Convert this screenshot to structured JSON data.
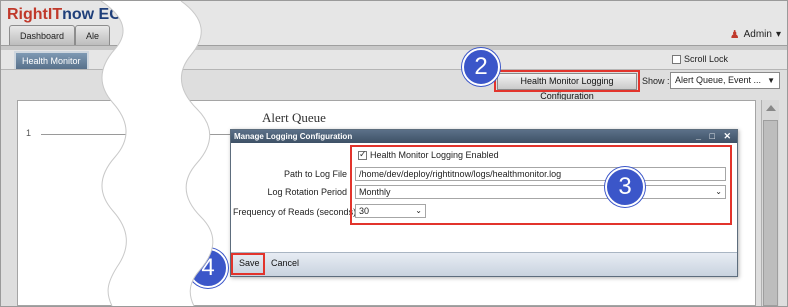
{
  "brand": {
    "part1": "Right",
    "part2": "IT",
    "part3": "now",
    "suffix": "ECM"
  },
  "user": {
    "name": "Admin"
  },
  "top_tabs": [
    {
      "label": "Dashboard"
    },
    {
      "label": "Ale"
    }
  ],
  "sub_tabs": [
    {
      "label": "Health Monitor"
    }
  ],
  "toolbar": {
    "scroll_lock_label": "Scroll Lock",
    "hmlc_button": "Health Monitor Logging Configuration",
    "show_label": "Show :",
    "show_value": "Alert Queue, Event ..."
  },
  "chart": {
    "title": "Alert Queue",
    "tick": "1"
  },
  "dialog": {
    "title": "Manage Logging Configuration",
    "controls": "_ □ ✕",
    "enabled_label": "Health Monitor Logging Enabled",
    "enabled_checked": true,
    "path_label": "Path to Log File",
    "path_value": "/home/dev/deploy/rightitnow/logs/healthmonitor.log",
    "rotation_label": "Log Rotation Period",
    "rotation_value": "Monthly",
    "frequency_label": "Frequency of Reads (seconds)",
    "frequency_value": "30",
    "save_label": "Save",
    "cancel_label": "Cancel"
  },
  "callouts": [
    "2",
    "3",
    "4"
  ],
  "colors": {
    "highlight": "#e2342c",
    "badge": "#3b56c9",
    "title_bar": "#3e5166"
  }
}
